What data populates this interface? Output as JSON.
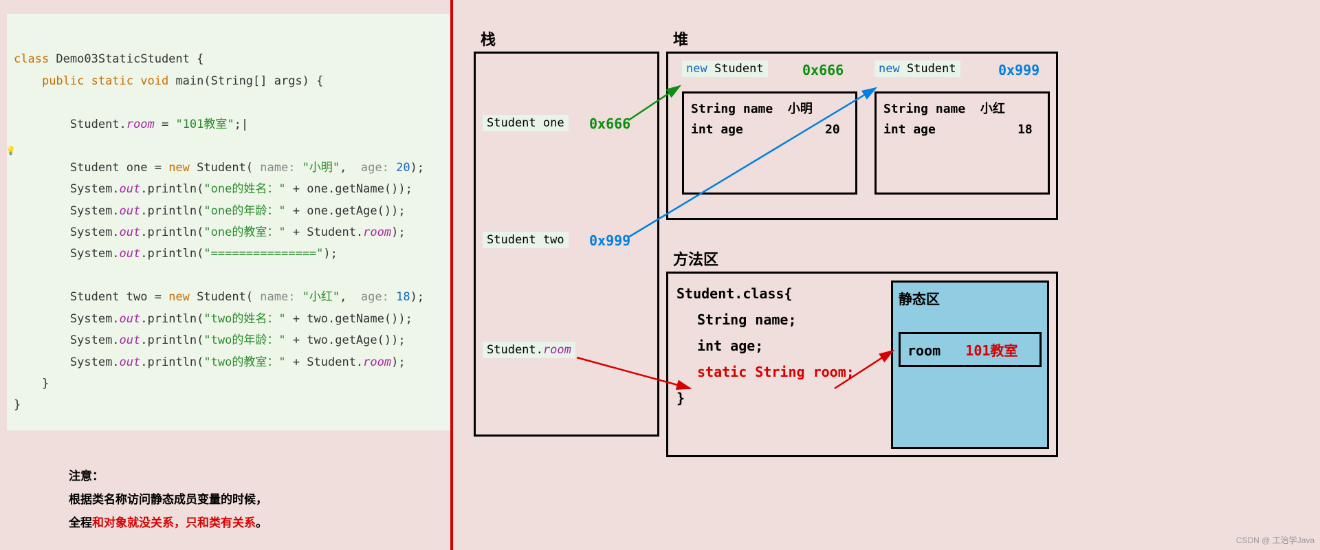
{
  "code": {
    "line1_kw": "class",
    "line1_name": " Demo03StaticStudent {",
    "line2_mods": "public static",
    "line2_void": " void",
    "line2_main": " main",
    "line2_args": "(String[] args) {",
    "line_room_a": "Student.",
    "line_room_b": "room",
    "line_room_c": " = ",
    "line_room_d": "\"101教室\"",
    "line_room_e": ";",
    "one_a": "Student one = ",
    "one_new": "new",
    "one_b": " Student( ",
    "one_p1k": "name: ",
    "one_p1v": "\"小明\"",
    "one_c": ",  ",
    "one_p2k": "age: ",
    "one_p2v": "20",
    "one_d": ");",
    "p1a": "System.",
    "p1b": "out",
    "p1c": ".println(",
    "p1d": "\"one的姓名：\"",
    "p1e": " + one.getName());",
    "p2a": "System.",
    "p2b": "out",
    "p2c": ".println(",
    "p2d": "\"one的年龄：\"",
    "p2e": " + one.getAge());",
    "p3a": "System.",
    "p3b": "out",
    "p3c": ".println(",
    "p3d": "\"one的教室：\"",
    "p3e": " + Student.",
    "p3f": "room",
    "p3g": ");",
    "p4a": "System.",
    "p4b": "out",
    "p4c": ".println(",
    "p4d": "\"===============\"",
    "p4e": ");",
    "two_a": "Student two = ",
    "two_new": "new",
    "two_b": " Student( ",
    "two_p1k": "name: ",
    "two_p1v": "\"小红\"",
    "two_c": ",  ",
    "two_p2k": "age: ",
    "two_p2v": "18",
    "two_d": ");",
    "q1a": "System.",
    "q1b": "out",
    "q1c": ".println(",
    "q1d": "\"two的姓名：\"",
    "q1e": " + two.getName());",
    "q2a": "System.",
    "q2b": "out",
    "q2c": ".println(",
    "q2d": "\"two的年龄：\"",
    "q2e": " + two.getAge());",
    "q3a": "System.",
    "q3b": "out",
    "q3c": ".println(",
    "q3d": "\"two的教室：\"",
    "q3e": " + Student.",
    "q3f": "room",
    "q3g": ");",
    "brace1": "    }",
    "brace2": "}"
  },
  "notes": {
    "l1": "注意：",
    "l2": "根据类名称访问静态成员变量的时候，",
    "l3a": "全程",
    "l3b": "和对象就没关系，只和类有关系",
    "l3c": "。"
  },
  "diagram": {
    "stack_label": "栈",
    "heap_label": "堆",
    "method_label": "方法区",
    "stack_one": "Student one",
    "stack_two": "Student two",
    "stack_room": "Student.",
    "stack_room_i": "room",
    "addr1": "0x666",
    "addr2": "0x999",
    "new_stu": "new",
    "new_stu2": " Student",
    "obj1_name_k": "String name",
    "obj1_name_v": "小明",
    "obj1_age_k": "int age",
    "obj1_age_v": "20",
    "obj2_name_k": "String name",
    "obj2_name_v": "小红",
    "obj2_age_k": "int age",
    "obj2_age_v": "18",
    "class_l1": "Student.class{",
    "class_l2": "String name;",
    "class_l3": "int age;",
    "class_l4": "static String room;",
    "class_l5": "}",
    "static_title": "静态区",
    "room_k": "room",
    "room_v": "101教室"
  },
  "watermark": "CSDN @ 工治学Java"
}
